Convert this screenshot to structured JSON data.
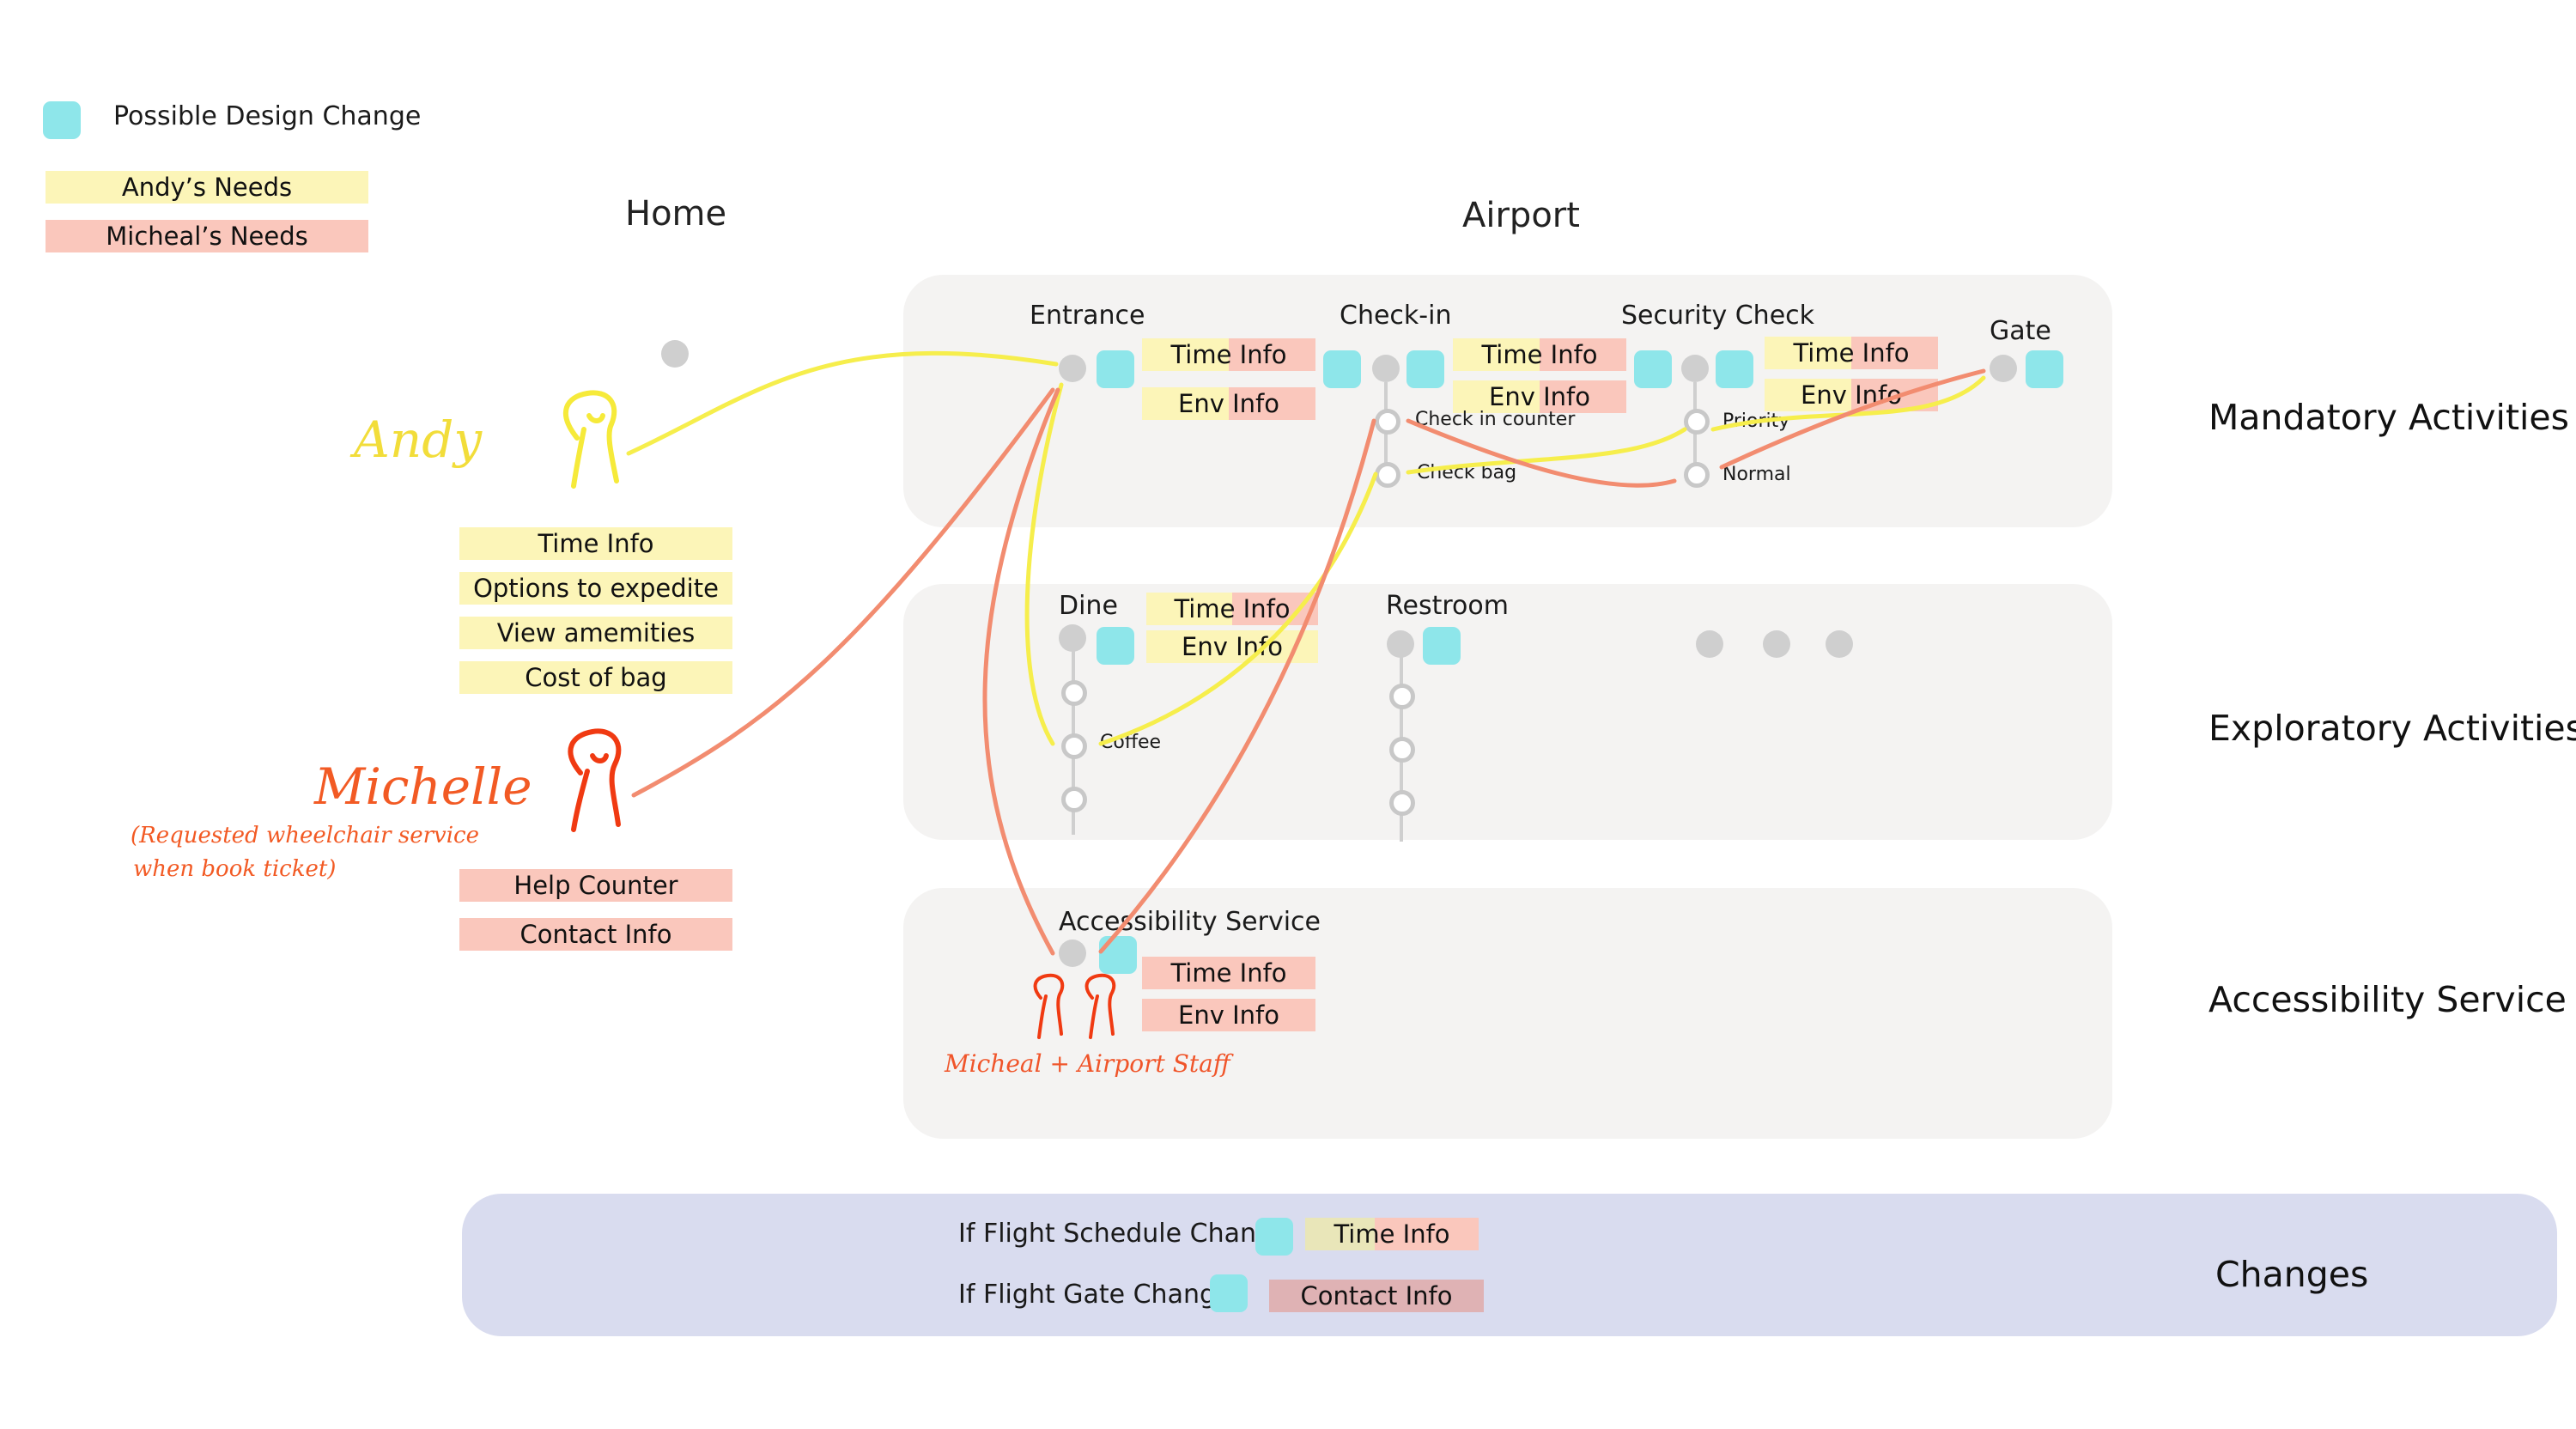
{
  "legend": {
    "design_change": "Possible Design Change",
    "andy_needs": "Andy’s Needs",
    "micheal_needs": "Micheal’s Needs"
  },
  "headings": {
    "home": "Home",
    "airport": "Airport"
  },
  "rows": {
    "mandatory": "Mandatory Activities",
    "exploratory": "Exploratory Activities",
    "accessibility": "Accessibility Service",
    "changes": "Changes"
  },
  "personas": {
    "andy": {
      "name": "Andy",
      "needs": [
        "Time Info",
        "Options to expedite",
        "View amemities",
        "Cost of bag"
      ]
    },
    "michelle": {
      "name": "Michelle",
      "note_line1": "(Requested wheelchair service",
      "note_line2": "when book ticket)",
      "needs": [
        "Help Counter",
        "Contact Info"
      ]
    }
  },
  "stations": {
    "entrance": {
      "title": "Entrance",
      "time": "Time Info",
      "env": "Env Info"
    },
    "checkin": {
      "title": "Check-in",
      "time": "Time Info",
      "env": "Env Info",
      "opt1": "Check in counter",
      "opt2": "Check bag"
    },
    "security": {
      "title": "Security Check",
      "time": "Time Info",
      "env": "Env Info",
      "opt1": "Priority",
      "opt2": "Normal"
    },
    "gate": {
      "title": "Gate"
    },
    "dine": {
      "title": "Dine",
      "time": "Time Info",
      "env": "Env Info",
      "opt": "Coffee"
    },
    "restroom": {
      "title": "Restroom"
    },
    "access": {
      "title": "Accessibility Service",
      "time": "Time Info",
      "env": "Env Info",
      "caption": "Micheal + Airport Staff"
    }
  },
  "changes": {
    "schedule": {
      "label": "If Flight Schedule Change",
      "tag": "Time Info"
    },
    "gate": {
      "label": "If Flight Gate Change",
      "tag": "Contact Info"
    }
  },
  "colors": {
    "design_change": "#8ee6ea",
    "andy": "#fcf5b8",
    "micheal": "#fac7bc",
    "andy_path": "#f6ee4c",
    "micheal_path": "#f28c70",
    "panel": "#f4f3f2",
    "changes_panel": "#d9dcef"
  }
}
